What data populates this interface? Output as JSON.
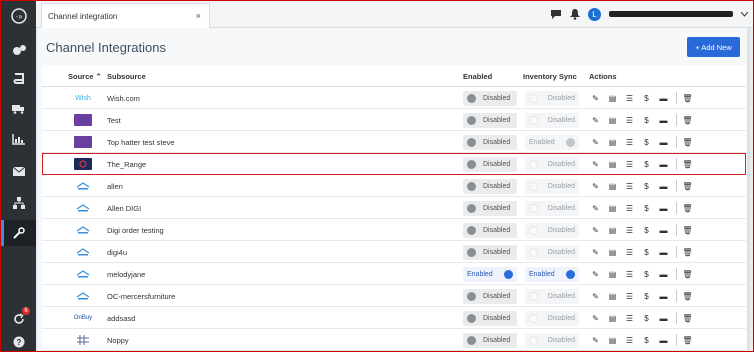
{
  "topbar": {
    "tab_title": "Channel integration",
    "close_glyph": "×",
    "avatar_letter": "L",
    "user_name": "redacted"
  },
  "page": {
    "title": "Channel Integrations",
    "add_button": "+ Add New"
  },
  "columns": {
    "source": "Source ⌃",
    "subsource": "Subsource",
    "enabled": "Enabled",
    "inventory_sync": "Inventory Sync",
    "actions": "Actions"
  },
  "sidebar": {
    "notification_count": "6"
  },
  "rows": [
    {
      "logo": "wish",
      "logo_text": "Wish",
      "subsource": "Wish.com",
      "enabled": "Disabled",
      "inventory": "Disabled"
    },
    {
      "logo": "purple",
      "logo_text": "",
      "subsource": "Test",
      "enabled": "Disabled",
      "inventory": "Disabled"
    },
    {
      "logo": "purple",
      "logo_text": "",
      "subsource": "Top hatter test steve",
      "enabled": "Disabled",
      "inventory": "Enabled"
    },
    {
      "logo": "range",
      "logo_text": "",
      "subsource": "The_Range",
      "enabled": "Disabled",
      "inventory": "Disabled"
    },
    {
      "logo": "bq",
      "logo_text": "",
      "subsource": "allen",
      "enabled": "Disabled",
      "inventory": "Disabled"
    },
    {
      "logo": "bq",
      "logo_text": "",
      "subsource": "Allen DIGI",
      "enabled": "Disabled",
      "inventory": "Disabled"
    },
    {
      "logo": "bq",
      "logo_text": "",
      "subsource": "Digi order testing",
      "enabled": "Disabled",
      "inventory": "Disabled"
    },
    {
      "logo": "bq",
      "logo_text": "",
      "subsource": "digi4u",
      "enabled": "Disabled",
      "inventory": "Disabled"
    },
    {
      "logo": "bq",
      "logo_text": "",
      "subsource": "melodyjane",
      "enabled": "Enabled",
      "inventory": "Enabled"
    },
    {
      "logo": "bq",
      "logo_text": "",
      "subsource": "OC-mercersfurniture",
      "enabled": "Disabled",
      "inventory": "Disabled"
    },
    {
      "logo": "onbuy",
      "logo_text": "OnBuy",
      "subsource": "addsasd",
      "enabled": "Disabled",
      "inventory": "Disabled"
    },
    {
      "logo": "grid",
      "logo_text": "",
      "subsource": "Noppy",
      "enabled": "Disabled",
      "inventory": "Disabled"
    }
  ],
  "icons": {
    "actions": [
      "pencil-icon",
      "document-icon",
      "list-icon",
      "dollar-icon",
      "truck-icon",
      "trash-icon"
    ],
    "sidebar": [
      "logo-icon",
      "puzzle-cogs-icon",
      "book-icon",
      "truck-icon",
      "chart-icon",
      "mail-icon",
      "sitemap-icon",
      "wrench-icon",
      "refresh-icon",
      "help-icon"
    ]
  },
  "colors": {
    "accent": "#2a6ad8",
    "sidebar": "#2c3136",
    "highlight": "#d32027"
  }
}
